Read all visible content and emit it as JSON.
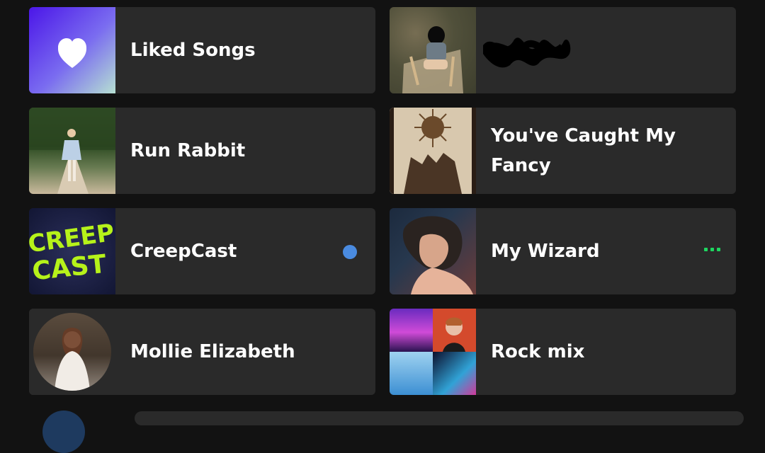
{
  "tiles": [
    {
      "label": "Liked Songs",
      "icon": "heart-icon"
    },
    {
      "label": "",
      "note": "redacted title"
    },
    {
      "label": "Run Rabbit"
    },
    {
      "label": "You've Caught My Fancy"
    },
    {
      "label": "CreepCast",
      "art_text": "CREEP CAST",
      "status": "new-episode-dot"
    },
    {
      "label": "My Wizard",
      "status": "playing-indicator"
    },
    {
      "label": "Mollie Elizabeth"
    },
    {
      "label": "Rock mix"
    }
  ],
  "colors": {
    "background": "#121212",
    "tile": "#2a2a2a",
    "text": "#ffffff",
    "dot_blue": "#4a8be0",
    "playing_green": "#1ed760",
    "liked_gradient_start": "#4b16e8",
    "liked_gradient_end": "#b6e0d2"
  }
}
